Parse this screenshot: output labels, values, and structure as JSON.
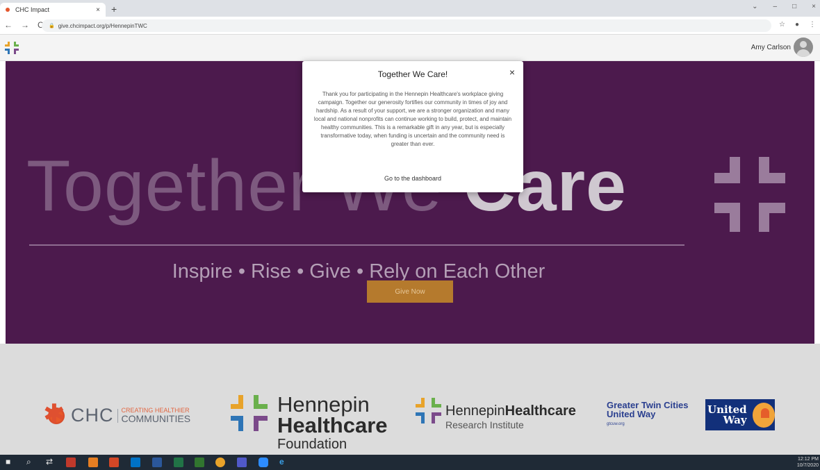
{
  "browser": {
    "tab_title": "CHC Impact",
    "tab_close": "×",
    "new_tab": "+",
    "url": "give.chcimpact.org/p/HennepinTWC",
    "nav_back": "←",
    "nav_forward": "→",
    "nav_reload": "C",
    "star_icon": "☆",
    "win_min": "–",
    "win_max": "□",
    "win_close": "×",
    "win_chevron": "⌄",
    "profile_icon": "●",
    "menu_icon": "⋮"
  },
  "header": {
    "user_name": "Amy Carlson"
  },
  "hero": {
    "title_part1": "Together We ",
    "title_part2": "Care",
    "tagline": "Inspire  •  Rise  •  Give  •  Rely on Each Other",
    "give_button": "Give Now"
  },
  "modal": {
    "title": "Together We Care!",
    "close": "×",
    "body": "Thank you for participating in the Hennepin Healthcare's workplace giving campaign. Together our generosity fortifies our community in times of joy and hardship. As a result of your support, we are a stronger organization and many local and national nonprofits can continue working to build, protect, and maintain healthy communities. This is a remarkable gift in any year, but is especially transformative today, when funding is uncertain and the community need is greater than ever.",
    "link": "Go to the dashboard"
  },
  "logos": {
    "chc_name": "CHC",
    "chc_sub1": "CREATING HEALTHIER",
    "chc_sub2": "COMMUNITIES",
    "hf_line1": "Hennepin",
    "hf_line2": "Healthcare",
    "hf_line3": "Foundation",
    "hri_part1": "Hennepin",
    "hri_part2": "Healthcare",
    "hri_line2": "Research Institute",
    "gtcuw_line1": "Greater Twin Cities",
    "gtcuw_line2": "United Way",
    "gtcuw_line3": "gtcuw.org",
    "uw_line1": "United",
    "uw_line2": "Way"
  },
  "taskbar": {
    "time": "12:12 PM",
    "date": "10/7/2020"
  },
  "colors": {
    "hero_bg": "#4c1a4d",
    "give_button": "#b57a2d",
    "logo_orange": "#e8a32a",
    "logo_green": "#6ab04c",
    "logo_blue": "#2e75b6",
    "logo_purple": "#7b4a8a"
  }
}
